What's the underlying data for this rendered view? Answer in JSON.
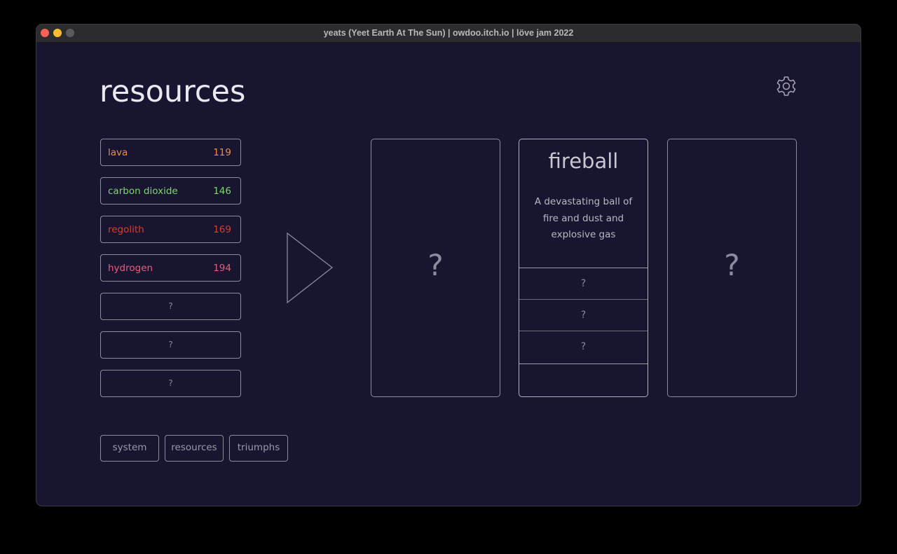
{
  "window": {
    "title": "yeats (Yeet Earth At The Sun) | owdoo.itch.io | löve jam 2022"
  },
  "page": {
    "title": "resources"
  },
  "icons": {
    "settings": "gear-icon",
    "craft": "play-triangle-icon"
  },
  "resources": [
    {
      "name": "lava",
      "count": "119",
      "color": "#e98f4a"
    },
    {
      "name": "carbon dioxide",
      "count": "146",
      "color": "#7fd66b"
    },
    {
      "name": "regolith",
      "count": "169",
      "color": "#e03a2c"
    },
    {
      "name": "hydrogen",
      "count": "194",
      "color": "#e85d77"
    },
    {
      "name": "?",
      "count": "",
      "color": "#8a8799"
    },
    {
      "name": "?",
      "count": "",
      "color": "#8a8799"
    },
    {
      "name": "?",
      "count": "",
      "color": "#8a8799"
    }
  ],
  "cards": {
    "left": {
      "label": "?"
    },
    "middle": {
      "name": "fireball",
      "description": "A devastating ball of fire and dust and explosive gas",
      "slots": [
        "?",
        "?",
        "?",
        ""
      ]
    },
    "right": {
      "label": "?"
    }
  },
  "tabs": [
    "system",
    "resources",
    "triumphs"
  ]
}
